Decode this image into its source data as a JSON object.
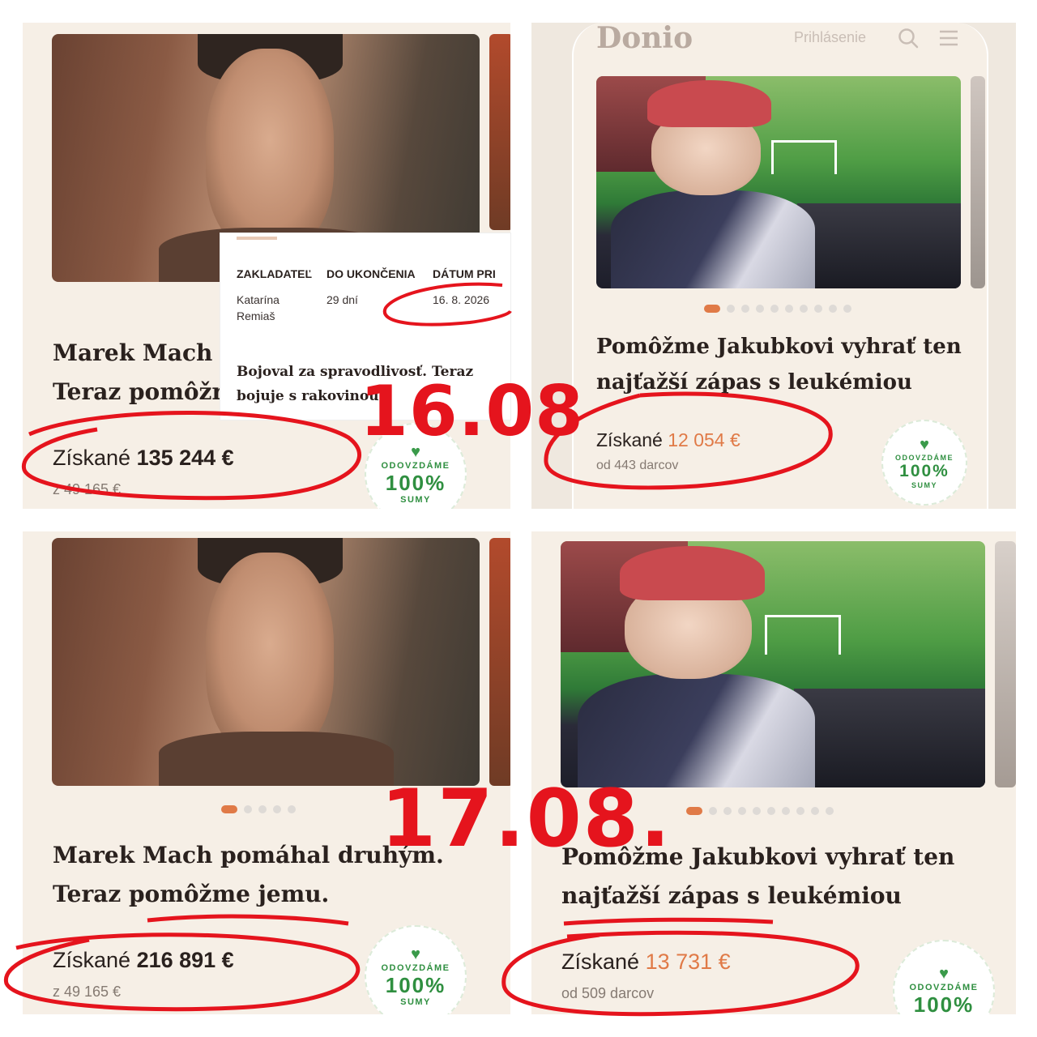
{
  "panels": [
    {
      "headline_line1": "Marek Mach p",
      "headline_line2": "Teraz pomôžr",
      "raised_label": "Získané",
      "raised_amount": "135 244 €",
      "goal_text": "z 49 165 €"
    },
    {
      "logo": "Donio",
      "login": "Prihlásenie",
      "headline_line1": "Pomôžme Jakubkovi vyhrať ten",
      "headline_line2": "najťažší zápas s leukémiou",
      "raised_label": "Získané",
      "raised_amount": "12 054 €",
      "donors_text": "od 443 darcov"
    },
    {
      "headline_line1": "Marek Mach pomáhal druhým.",
      "headline_line2": "Teraz pomôžme jemu.",
      "raised_label": "Získané",
      "raised_amount": "216 891 €",
      "goal_text": "z 49 165 €"
    },
    {
      "headline_line1": "Pomôžme Jakubkovi vyhrať ten",
      "headline_line2": "najťažší zápas s leukémiou",
      "raised_label": "Získané",
      "raised_amount": "13 731 €",
      "donors_text": "od 509 darcov"
    }
  ],
  "details_card": {
    "col1_header": "ZAKLADATEĽ",
    "col2_header": "DO UKONČENIA",
    "col3_header": "DÁTUM PRI",
    "founder_line1": "Katarína",
    "founder_line2": "Remiaš",
    "remaining": "29 dní",
    "date": "16. 8. 2026",
    "story": "Bojoval za spravodlivosť. Teraz bojuje s rakovinou"
  },
  "badge": {
    "line1": "ODOVZDÁME",
    "line2": "100%",
    "line3": "SUMY",
    "icon": "heart-hand-icon"
  },
  "stamps": {
    "first": "16.08",
    "second": "17.08."
  },
  "carousel": {
    "p2_count": 10,
    "p3_count": 5,
    "p4_count": 10
  },
  "colors": {
    "accent_orange": "#e07a47",
    "stamp_red": "#e5141d",
    "badge_green": "#2f8f40",
    "panel_bg": "#f6efe6"
  }
}
